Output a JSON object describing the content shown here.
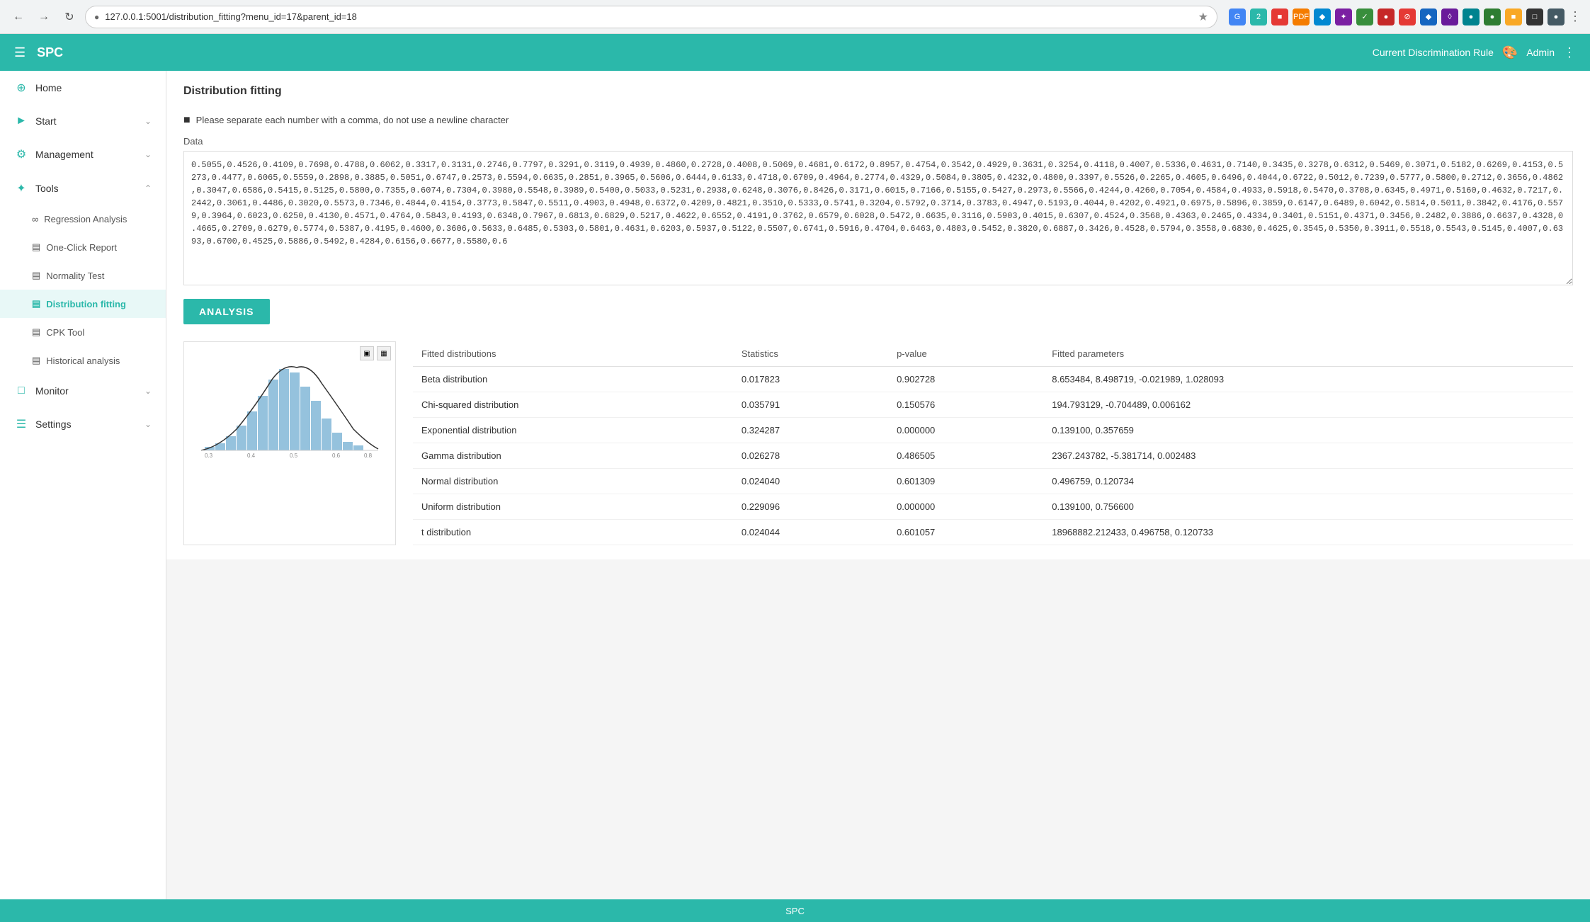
{
  "browser": {
    "url": "127.0.0.1:5001/distribution_fitting?menu_id=17&parent_id=18",
    "favicon": "●"
  },
  "header": {
    "menu_icon": "☰",
    "title": "SPC",
    "discrimination_rule_label": "Current Discrimination Rule",
    "palette_icon": "🎨",
    "admin_label": "Admin",
    "admin_menu_icon": "⋮"
  },
  "sidebar": {
    "items": [
      {
        "id": "home",
        "label": "Home",
        "icon": "⊕",
        "has_arrow": false
      },
      {
        "id": "start",
        "label": "Start",
        "icon": "▷",
        "has_arrow": true
      },
      {
        "id": "management",
        "label": "Management",
        "icon": "⚙",
        "has_arrow": true
      },
      {
        "id": "tools",
        "label": "Tools",
        "icon": "✦",
        "has_arrow": true,
        "expanded": true
      }
    ],
    "tools_sub_items": [
      {
        "id": "regression",
        "label": "Regression Analysis",
        "icon": "∞"
      },
      {
        "id": "one-click",
        "label": "One-Click Report",
        "icon": "📄"
      },
      {
        "id": "normality",
        "label": "Normality Test",
        "icon": "📊"
      },
      {
        "id": "distribution",
        "label": "Distribution fitting",
        "icon": "⊞",
        "active": true
      },
      {
        "id": "cpk",
        "label": "CPK Tool",
        "icon": "📋"
      },
      {
        "id": "historical",
        "label": "Historical analysis",
        "icon": "📅"
      }
    ],
    "other_items": [
      {
        "id": "monitor",
        "label": "Monitor",
        "icon": "⊞",
        "has_arrow": true
      },
      {
        "id": "settings",
        "label": "Settings",
        "icon": "☰",
        "has_arrow": true
      }
    ]
  },
  "page": {
    "title": "Distribution fitting",
    "instruction": "Please separate each number with a comma, do not use a newline character",
    "data_label": "Data",
    "data_content": "0.5055,0.4526,0.4109,0.7698,0.4788,0.6062,0.3317,0.3131,0.2746,0.7797,0.3291,0.3119,0.4939,0.4860,0.2728,0.4008,0.5069,0.4681,0.6172,0.8957,0.4754,0.3542,0.4929,0.3631,0.3254,0.4118,0.4007,0.5336,0.4631,0.7140,0.3435,0.3278,0.6312,0.5469,0.3071,0.5182,0.6269,0.4153,0.5273,0.4477,0.6065,0.5559,0.2898,0.3885,0.5051,0.6747,0.2573,0.5594,0.6635,0.2851,0.3965,0.5606,0.6444,0.6133,0.4718,0.6709,0.4964,0.2774,0.4329,0.5084,0.3805,0.4232,0.4800,0.3397,0.5526,0.2265,0.4605,0.6496,0.4044,0.6722,0.5012,0.7239,0.5777,0.5800,0.2712,0.3656,0.4862,0.3047,0.6586,0.5415,0.5125,0.5800,0.7355,0.6074,0.7304,0.3980,0.5548,0.3989,0.5400,0.5033,0.5231,0.2938,0.6248,0.3076,0.8426,0.3171,0.6015,0.7166,0.5155,0.5427,0.2973,0.5566,0.4244,0.4260,0.7054,0.4584,0.4933,0.5918,0.5470,0.3708,0.6345,0.4971,0.5160,0.4632,0.7217,0.2442,0.3061,0.4486,0.3020,0.5573,0.7346,0.4844,0.4154,0.3773,0.5847,0.5511,0.4903,0.4948,0.6372,0.4209,0.4821,0.3510,0.5333,0.5741,0.3204,0.5792,0.3714,0.3783,0.4947,0.5193,0.4044,0.4202,0.4921,0.6975,0.5896,0.3859,0.6147,0.6489,0.6042,0.5814,0.5011,0.3842,0.4176,0.5579,0.3964,0.6023,0.6250,0.4130,0.4571,0.4764,0.5843,0.4193,0.6348,0.7967,0.6813,0.6829,0.5217,0.4622,0.6552,0.4191,0.3762,0.6579,0.6028,0.5472,0.6635,0.3116,0.5903,0.4015,0.6307,0.4524,0.3568,0.4363,0.2465,0.4334,0.3401,0.5151,0.4371,0.3456,0.2482,0.3886,0.6637,0.4328,0.4665,0.2709,0.6279,0.5774,0.5387,0.4195,0.4600,0.3606,0.5633,0.6485,0.5303,0.5801,0.4631,0.6203,0.5937,0.5122,0.5507,0.6741,0.5916,0.4704,0.6463,0.4803,0.5452,0.3820,0.6887,0.3426,0.4528,0.5794,0.3558,0.6830,0.4625,0.3545,0.5350,0.3911,0.5518,0.5543,0.5145,0.4007,0.6393,0.6700,0.4525,0.5886,0.5492,0.4284,0.6156,0.6677,0.5580,0.6",
    "analysis_button_label": "ANALYSIS"
  },
  "results": {
    "table_headers": [
      "Fitted distributions",
      "Statistics",
      "p-value",
      "Fitted parameters"
    ],
    "rows": [
      {
        "distribution": "Beta distribution",
        "statistics": "0.017823",
        "p_value": "0.902728",
        "fitted_params": "8.653484, 8.498719, -0.021989, 1.028093"
      },
      {
        "distribution": "Chi-squared distribution",
        "statistics": "0.035791",
        "p_value": "0.150576",
        "fitted_params": "194.793129, -0.704489, 0.006162"
      },
      {
        "distribution": "Exponential distribution",
        "statistics": "0.324287",
        "p_value": "0.000000",
        "fitted_params": "0.139100, 0.357659"
      },
      {
        "distribution": "Gamma distribution",
        "statistics": "0.026278",
        "p_value": "0.486505",
        "fitted_params": "2367.243782, -5.381714, 0.002483"
      },
      {
        "distribution": "Normal distribution",
        "statistics": "0.024040",
        "p_value": "0.601309",
        "fitted_params": "0.496759, 0.120734"
      },
      {
        "distribution": "Uniform distribution",
        "statistics": "0.229096",
        "p_value": "0.000000",
        "fitted_params": "0.139100, 0.756600"
      },
      {
        "distribution": "t distribution",
        "statistics": "0.024044",
        "p_value": "0.601057",
        "fitted_params": "18968882.212433, 0.496758, 0.120733"
      }
    ]
  },
  "footer": {
    "label": "SPC"
  },
  "colors": {
    "teal": "#2bb8aa",
    "teal_light": "#e8f8f7",
    "active_bg": "#4cc9bd"
  }
}
